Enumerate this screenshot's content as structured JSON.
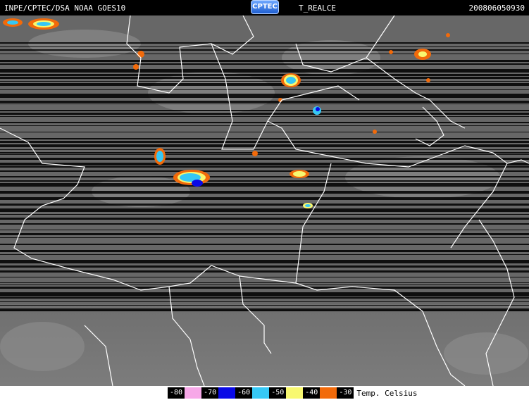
{
  "header": {
    "source": "INPE/CPTEC/DSA  NOAA  GOES10",
    "logo_text": "CPTEC",
    "product": "T_REALCE",
    "timestamp": "200806050930"
  },
  "legend": {
    "items": [
      {
        "label": "-80",
        "color": "#f7a8e8"
      },
      {
        "label": "-70",
        "color": "#0a0ae6"
      },
      {
        "label": "-60",
        "color": "#36c8f5"
      },
      {
        "label": "-50",
        "color": "#f8f870"
      },
      {
        "label": "-40",
        "color": "#f26a0a"
      },
      {
        "label": "-30",
        "color": ""
      }
    ],
    "unit_label": "Temp. Celsius"
  },
  "colors": {
    "background_gray": "#6a6a6a",
    "scan_line": "#000000",
    "border_line": "#ffffff"
  }
}
